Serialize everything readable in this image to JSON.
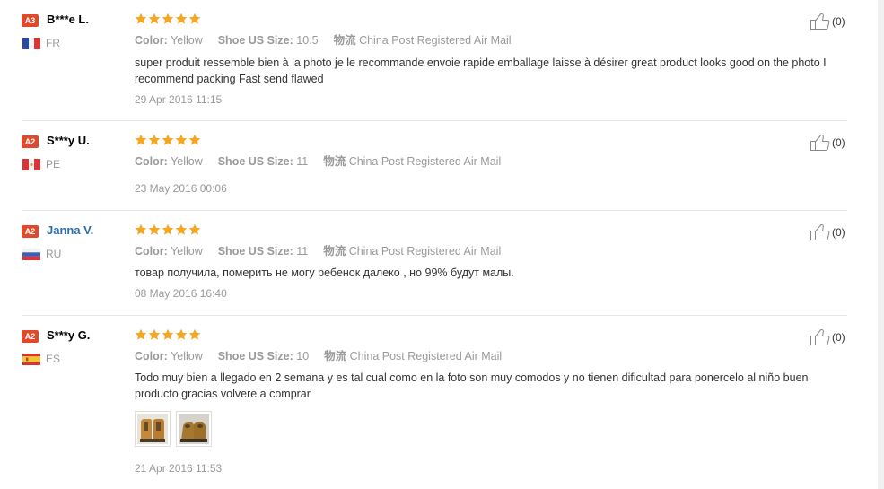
{
  "reviews": [
    {
      "badge": "A3",
      "badge_color": "#e0492b",
      "name": "B***e L.",
      "name_color": "#000000",
      "country_code": "FR",
      "flag": "flag-fr",
      "rating": 5,
      "color_label": "Color:",
      "color_value": "Yellow",
      "size_label": "Shoe US Size:",
      "size_value": "10.5",
      "logistics_label": "物流",
      "logistics_value": "China Post Registered Air Mail",
      "text": "super produit ressemble bien à la photo je le recommande envoie rapide emballage laisse à désirer great product looks good on the photo I recommend packing Fast send flawed",
      "date": "29 Apr 2016 11:15",
      "helpful": "(0)",
      "photos": []
    },
    {
      "badge": "A2",
      "badge_color": "#e0492b",
      "name": "S***y U.",
      "name_color": "#000000",
      "country_code": "PE",
      "flag": "flag-pe",
      "rating": 5,
      "color_label": "Color:",
      "color_value": "Yellow",
      "size_label": "Shoe US Size:",
      "size_value": "11",
      "logistics_label": "物流",
      "logistics_value": "China Post Registered Air Mail",
      "text": "",
      "date": "23 May 2016 00:06",
      "helpful": "(0)",
      "photos": []
    },
    {
      "badge": "A2",
      "badge_color": "#e0492b",
      "name": "Janna V.",
      "name_color": "#2a6fb0",
      "country_code": "RU",
      "flag": "flag-ru",
      "rating": 5,
      "color_label": "Color:",
      "color_value": "Yellow",
      "size_label": "Shoe US Size:",
      "size_value": "11",
      "logistics_label": "物流",
      "logistics_value": "China Post Registered Air Mail",
      "text": "товар получила, померить не могу ребенок далеко , но 99% будут малы.",
      "date": "08 May 2016 16:40",
      "helpful": "(0)",
      "photos": []
    },
    {
      "badge": "A2",
      "badge_color": "#e0492b",
      "name": "S***y G.",
      "name_color": "#000000",
      "country_code": "ES",
      "flag": "flag-es",
      "rating": 5,
      "color_label": "Color:",
      "color_value": "Yellow",
      "size_label": "Shoe US Size:",
      "size_value": "10",
      "logistics_label": "物流",
      "logistics_value": "China Post Registered Air Mail",
      "text": "Todo muy bien a llegado en 2 semana y es tal cual como en la foto son muy comodos y no tienen dificultad para ponercelo al niño buen producto gracias volvere a comprar",
      "date": "21 Apr 2016 11:53",
      "helpful": "(0)",
      "photos": [
        "boot-photo-1",
        "boot-photo-2"
      ]
    }
  ],
  "colors": {
    "star": "#f5a623",
    "muted_text": "#999999",
    "divider": "#e6e6e6"
  }
}
